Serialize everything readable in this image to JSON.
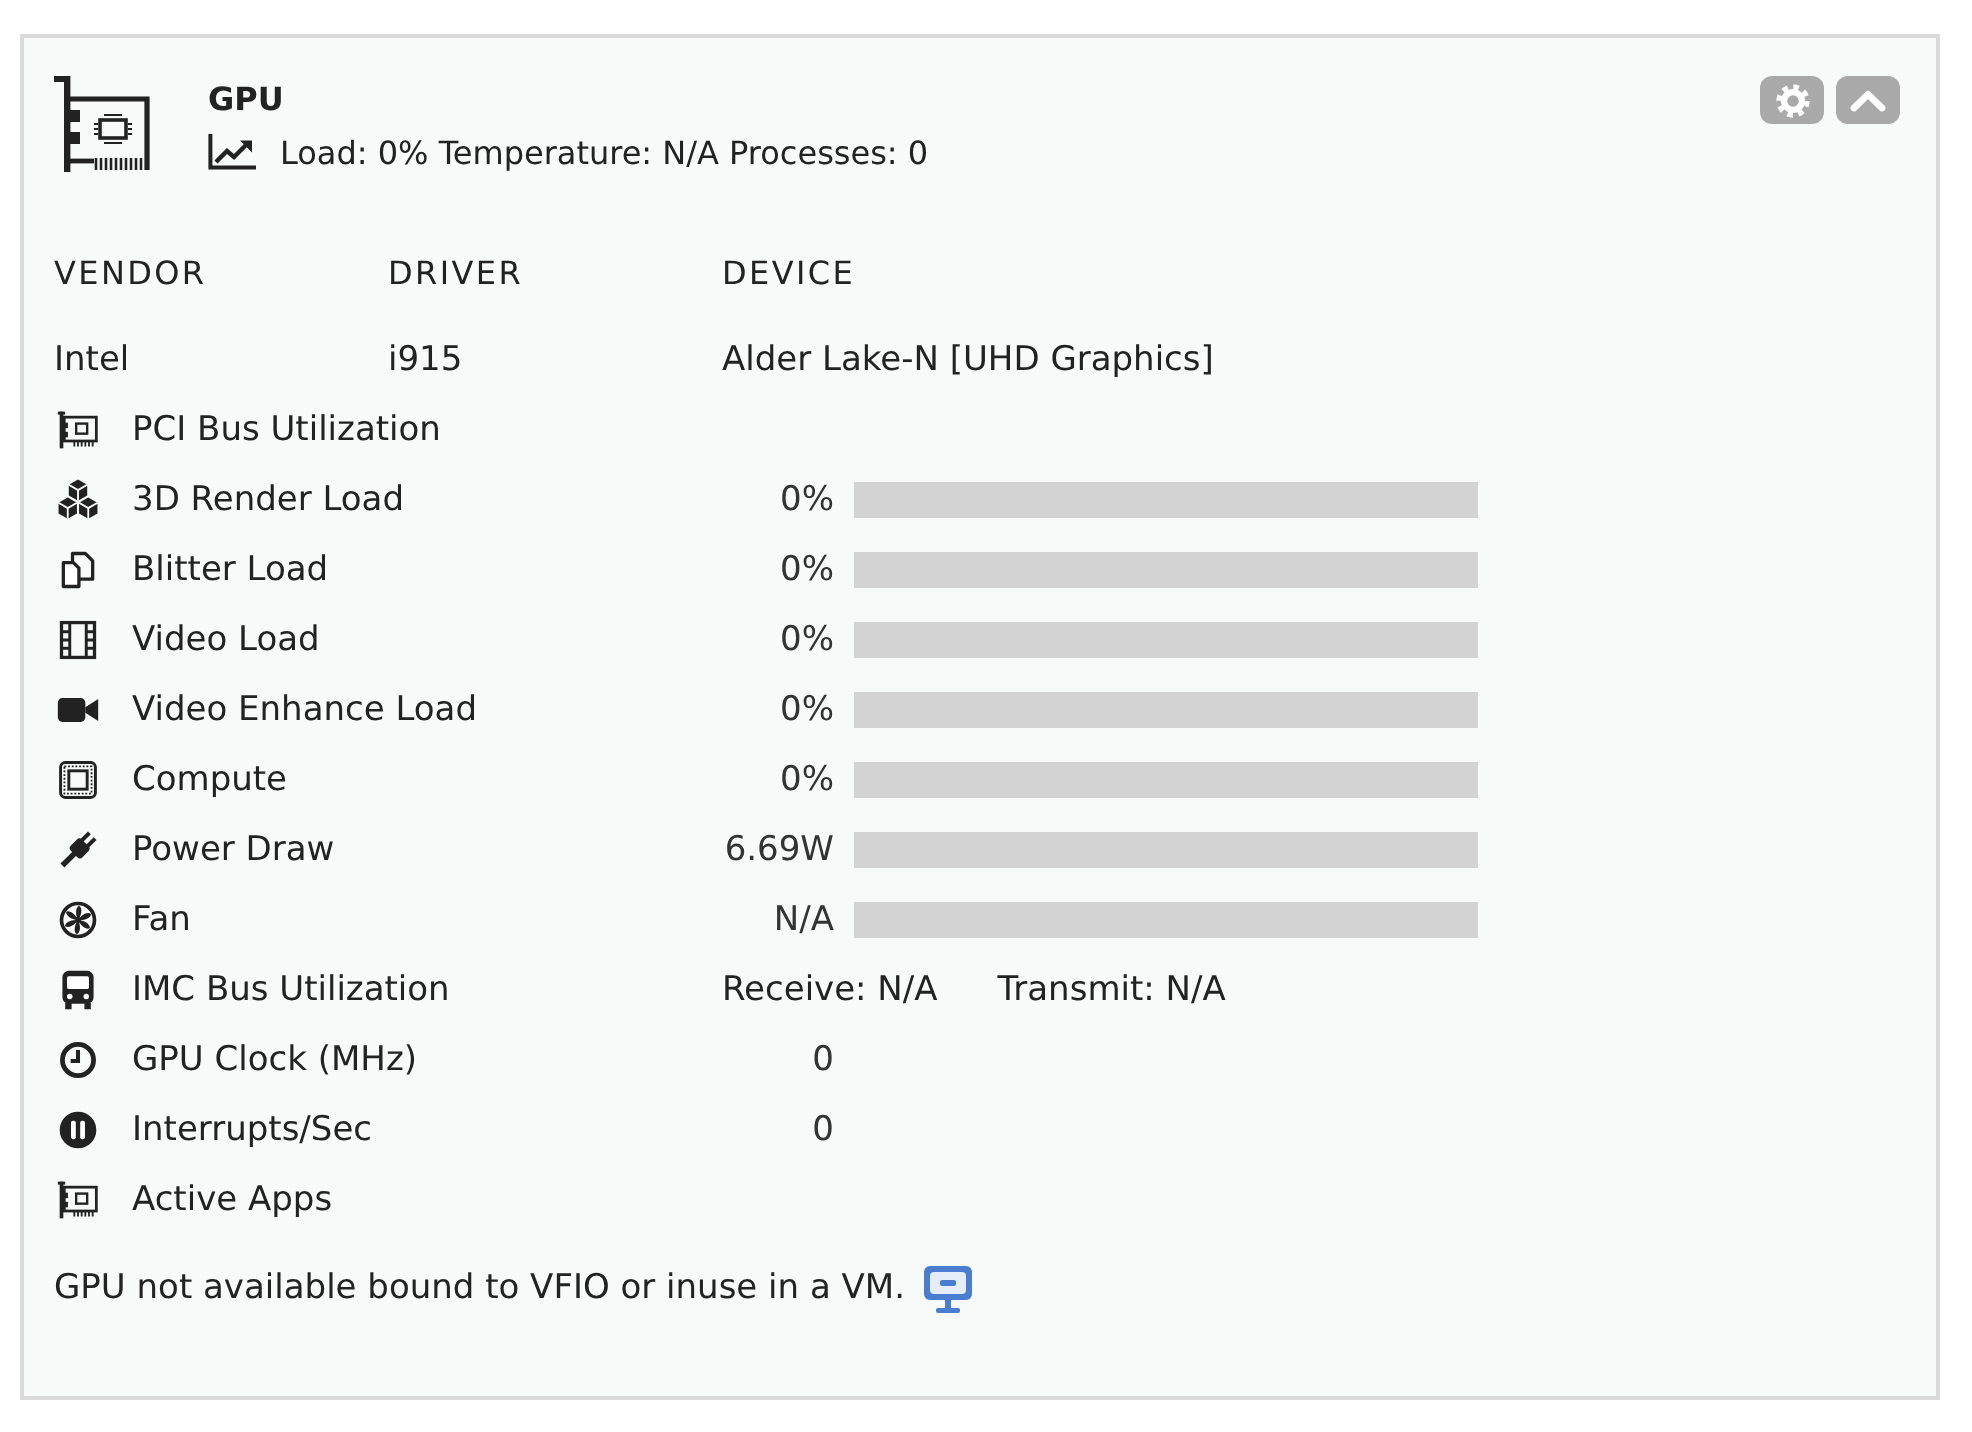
{
  "panel": {
    "title": "GPU",
    "summary": "Load: 0% Temperature: N/A Processes: 0"
  },
  "device_table": {
    "columns": [
      "VENDOR",
      "DRIVER",
      "DEVICE"
    ],
    "rows": [
      [
        "Intel",
        "i915",
        "Alder Lake-N [UHD Graphics]"
      ]
    ]
  },
  "metrics": [
    {
      "kind": "label",
      "label": "PCI Bus Utilization"
    },
    {
      "kind": "bar",
      "label": "3D Render Load",
      "reading": "0%",
      "level": 0
    },
    {
      "kind": "bar",
      "label": "Blitter Load",
      "reading": "0%",
      "level": 0
    },
    {
      "kind": "bar",
      "label": "Video Load",
      "reading": "0%",
      "level": 0
    },
    {
      "kind": "bar",
      "label": "Video Enhance Load",
      "reading": "0%",
      "level": 0
    },
    {
      "kind": "bar",
      "label": "Compute",
      "reading": "0%",
      "level": 0
    },
    {
      "kind": "bar",
      "label": "Power Draw",
      "reading": "6.69W",
      "level": 0
    },
    {
      "kind": "bar",
      "label": "Fan",
      "reading": "N/A",
      "level": 0
    },
    {
      "kind": "pair",
      "label": "IMC Bus Utilization",
      "values": [
        "Receive: N/A",
        "Transmit: N/A"
      ]
    },
    {
      "kind": "value",
      "label": "GPU Clock (MHz)",
      "reading": "0"
    },
    {
      "kind": "value",
      "label": "Interrupts/Sec",
      "reading": "0"
    },
    {
      "kind": "label",
      "label": "Active Apps"
    }
  ],
  "note": "GPU not available bound to VFIO or inuse in a VM."
}
